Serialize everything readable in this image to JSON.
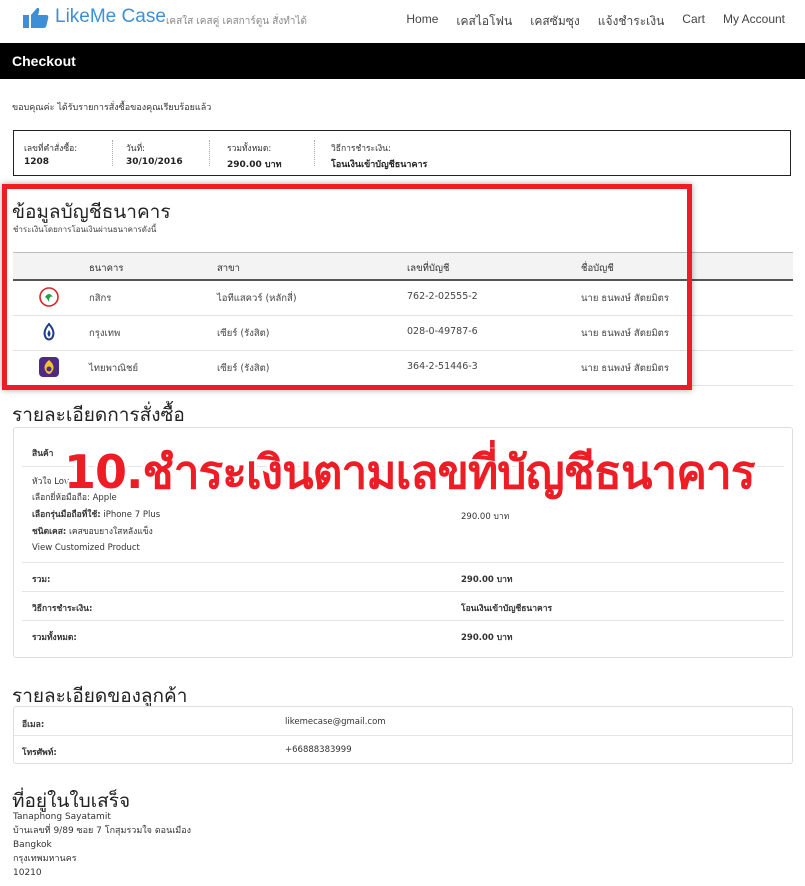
{
  "brand": {
    "name": "LikeMe Case",
    "tagline": "เคสใส เคสคู่ เคสการ์ตูน สั่งทำได้",
    "logo_icon": "thumbs-up-logo-icon",
    "color": "#3f8fd6"
  },
  "nav": [
    "Home",
    "เคสไอโฟน",
    "เคสซัมซุง",
    "แจ้งชำระเงิน",
    "Cart",
    "My Account"
  ],
  "page_title": "Checkout",
  "thanks": "ขอบคุณค่ะ ได้รับรายการสั่งซื้อของคุณเรียบร้อยแล้ว",
  "overview": {
    "order_label": "เลขที่คำสั่งซื้อ:",
    "order_value": "1208",
    "date_label": "วันที่:",
    "date_value": "30/10/2016",
    "total_label": "รวมทั้งหมด:",
    "total_value": "290.00 บาท",
    "method_label": "วิธีการชำระเงิน:",
    "method_value": "โอนเงินเข้าบัญชีธนาคาร"
  },
  "bank": {
    "title": "ข้อมูลบัญชีธนาคาร",
    "subtitle": "ชำระเงินโดยการโอนเงินผ่านธนาคารดังนี้",
    "headers": {
      "bank": "ธนาคาร",
      "branch": "สาขา",
      "account": "เลขที่บัญชี",
      "name": "ชื่อบัญชี"
    },
    "rows": [
      {
        "icon": "kasikorn-bank-icon",
        "bank": "กสิกร",
        "branch": "ไอทีแสควร์ (หลักสี่)",
        "account": "762-2-02555-2",
        "name": "นาย ธนพงษ์ สัตยมิตร",
        "color": "#1ba345"
      },
      {
        "icon": "bangkok-bank-icon",
        "bank": "กรุงเทพ",
        "branch": "เซียร์ (รังสิต)",
        "account": "028-0-49787-6",
        "name": "นาย ธนพงษ์ สัตยมิตร",
        "color": "#1e3c8c"
      },
      {
        "icon": "scb-bank-icon",
        "bank": "ไทยพาณิชย์",
        "branch": "เซียร์ (รังสิต)",
        "account": "364-2-51446-3",
        "name": "นาย ธนพงษ์ สัตยมิตร",
        "color": "#4e2a84"
      }
    ]
  },
  "highlight_color": "#ee1c25",
  "order_details": {
    "title": "รายละเอียดการสั่งซื้อ",
    "product_header": "สินค้า",
    "item_name": "หัวใจ Lov",
    "attr1": "เลือกยี่ห้อมือถือ: Apple",
    "attr2_label": "เลือกรุ่นมือถือที่ใช้:",
    "attr2_value": "iPhone 7 Plus",
    "attr3_label": "ชนิดเคส:",
    "attr3_value": "เคสขอบยางใสหลังแข็ง",
    "view_link": "View Customized Product",
    "item_price": "290.00 บาท",
    "subtotal_label": "รวม:",
    "subtotal_value": "290.00 บาท",
    "method_label": "วิธีการชำระเงิน:",
    "method_value": "โอนเงินเข้าบัญชีธนาคาร",
    "total_label": "รวมทั้งหมด:",
    "total_value": "290.00 บาท"
  },
  "overlay_text": "10.ชำระเงินตามเลขที่บัญชีธนาคาร",
  "customer": {
    "title": "รายละเอียดของลูกค้า",
    "email_label": "อีเมล:",
    "email": "likemecase@gmail.com",
    "phone_label": "โทรศัพท์:",
    "phone": "+66888383999"
  },
  "address": {
    "title": "ที่อยู่ในใบเสร็จ",
    "lines": [
      "Tanaphong Sayatamit",
      "บ้านเลขที่ 9/89 ซอย 7 โกสุมรวมใจ ดอนเมือง",
      "Bangkok",
      "กรุงเทพมหานคร",
      "10210"
    ]
  }
}
